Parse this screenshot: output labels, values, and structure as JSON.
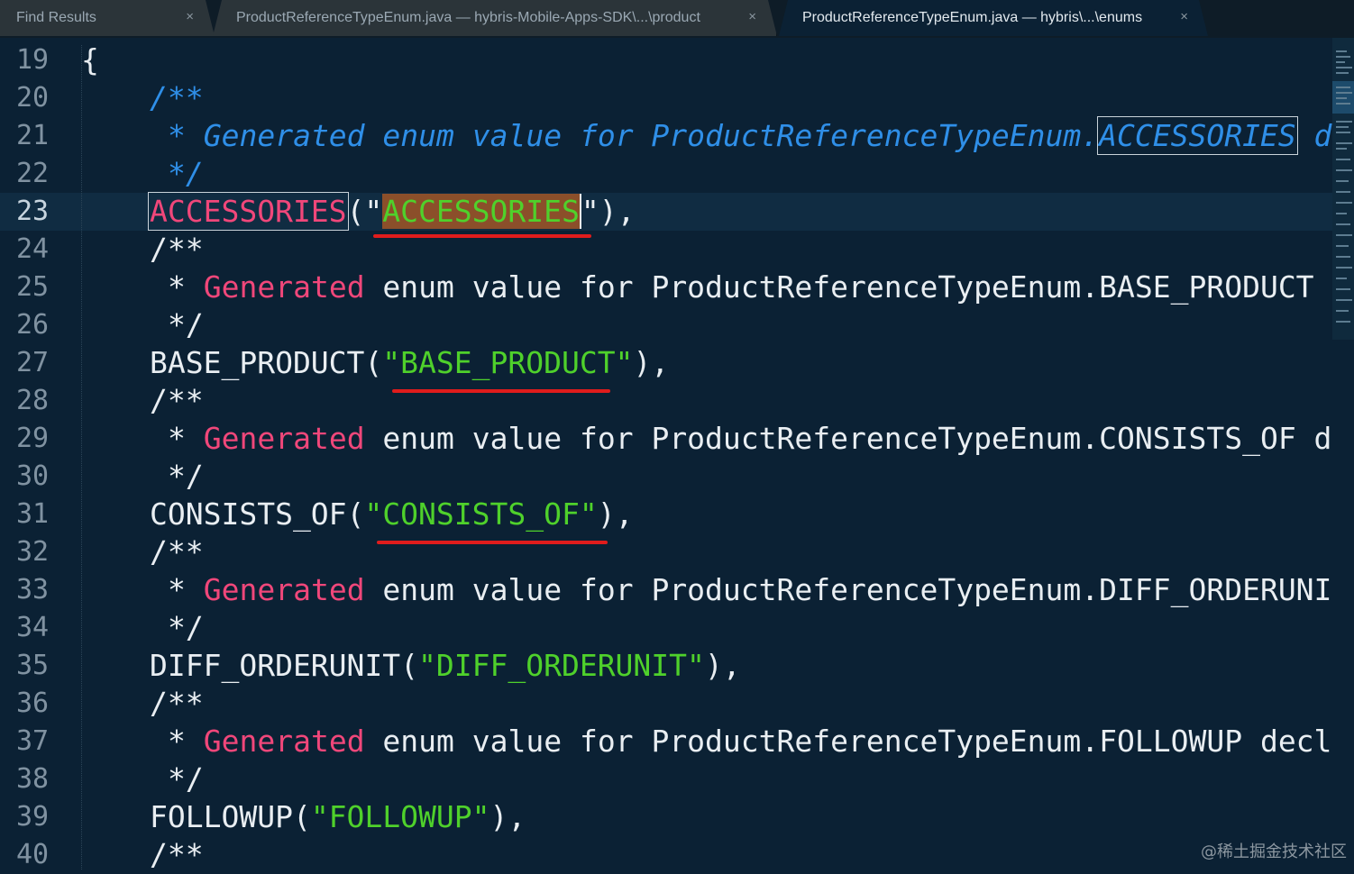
{
  "tabs": [
    {
      "label": "Find Results",
      "close": "×"
    },
    {
      "label": "ProductReferenceTypeEnum.java — hybris-Mobile-Apps-SDK\\...\\product",
      "close": "×"
    },
    {
      "label": "ProductReferenceTypeEnum.java — hybris\\...\\enums",
      "close": "×"
    }
  ],
  "line_numbers": [
    "19",
    "20",
    "21",
    "22",
    "23",
    "24",
    "25",
    "26",
    "27",
    "28",
    "29",
    "30",
    "31",
    "32",
    "33",
    "34",
    "35",
    "36",
    "37",
    "38",
    "39",
    "40"
  ],
  "code": {
    "l19": "{",
    "l20": "/**",
    "l21_star": "* Generated enum value for ProductReferenceTypeEnum.",
    "l21_box": "ACCESSORIES",
    "l21_tail": " de",
    "l22": "*/",
    "l23_name": "ACCESSORIES",
    "l23_open": "(\"",
    "l23_str": "ACCESSORIES",
    "l23_close": "\"),",
    "l24": "/**",
    "l25_star": "* ",
    "l25_gen": "Generated",
    "l25_rest": " enum value for ProductReferenceTypeEnum.BASE_PRODUCT de",
    "l26": "*/",
    "l27_name": "BASE_PRODUCT(",
    "l27_str": "\"BASE_PRODUCT\"",
    "l27_close": "),",
    "l28": "/**",
    "l29_star": "* ",
    "l29_gen": "Generated",
    "l29_rest": " enum value for ProductReferenceTypeEnum.CONSISTS_OF de",
    "l30": "*/",
    "l31_name": "CONSISTS_OF(",
    "l31_str": "\"CONSISTS_OF\"",
    "l31_close": "),",
    "l32": "/**",
    "l33_star": "* ",
    "l33_gen": "Generated",
    "l33_rest": " enum value for ProductReferenceTypeEnum.DIFF_ORDERUNIT",
    "l34": "*/",
    "l35_name": "DIFF_ORDERUNIT(",
    "l35_str": "\"DIFF_ORDERUNIT\"",
    "l35_close": "),",
    "l36": "/**",
    "l37_star": "* ",
    "l37_gen": "Generated",
    "l37_rest": " enum value for ProductReferenceTypeEnum.FOLLOWUP decla",
    "l38": "*/",
    "l39_name": "FOLLOWUP(",
    "l39_str": "\"FOLLOWUP\"",
    "l39_close": "),",
    "l40": "/**"
  },
  "watermark": "@稀土掘金技术社区",
  "colors": {
    "background": "#0b2134",
    "comment": "#2f8fe8",
    "string": "#4fd12b",
    "keyword_pink": "#f0477a",
    "annotation_red": "#e01c1c",
    "find_highlight": "#8b4f2a"
  }
}
